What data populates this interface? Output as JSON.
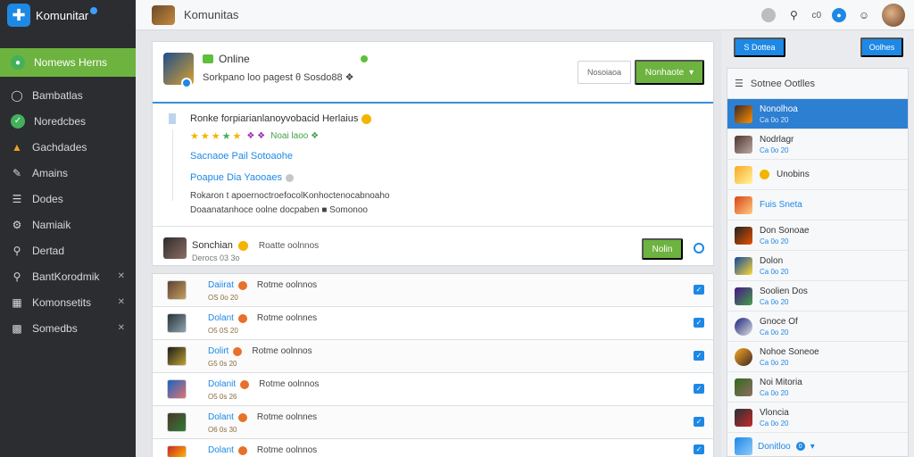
{
  "brand": {
    "name": "Komunitar"
  },
  "sidebar": {
    "items": [
      {
        "label": "Nomews Herns",
        "icon": "globe-icon",
        "active": true
      },
      {
        "label": "Bambatlas",
        "icon": "circle-icon"
      },
      {
        "label": "Noredcbes",
        "icon": "check-circle-icon"
      },
      {
        "label": "Gachdades",
        "icon": "chart-icon"
      },
      {
        "label": "Amains",
        "icon": "pen-icon"
      },
      {
        "label": "Dodes",
        "icon": "list-icon"
      },
      {
        "label": "Namiaik",
        "icon": "settings-icon"
      },
      {
        "label": "Dertad",
        "icon": "pin-icon"
      },
      {
        "label": "BantKorodmik",
        "icon": "search-icon",
        "suffix": "✕"
      },
      {
        "label": "Komonsetits",
        "icon": "grid-icon",
        "suffix": "✕"
      },
      {
        "label": "Somedbs",
        "icon": "bar-chart-icon",
        "suffix": "✕"
      }
    ]
  },
  "topbar": {
    "title": "Komunitas",
    "text_1": "c0",
    "icon_glyph": "☺"
  },
  "post": {
    "status": "Online",
    "subline": "Sorkpano loo pagest  θ  Sosdo88  ❖",
    "btn_outline": "Nosoiaoa",
    "btn_primary": "Nonhaote",
    "title": "Ronke forpiarianlanoyvobacid Herlaius",
    "stars_meta_1": "❖ ❖",
    "stars_meta_2": "Noai laoo  ❖",
    "link_1": "Sacnaoe Pail Sotoaohe",
    "link_2": "Poapue Dia Yaooaes",
    "desc_1": "Rokaron t apoernoctroefocolKonhoctenocabnoaho",
    "desc_2": "Doaanatanhoce oolne docpaben  ■  Somonoo"
  },
  "reply": {
    "name": "Sonchian",
    "status": "Roatte oolnnos",
    "sub": "Derocs 03 3o",
    "button": "Nolin"
  },
  "feed": {
    "rows": [
      {
        "name": "Daiirat",
        "status": "Rotme oolnnos",
        "sub": "OS 0o 20"
      },
      {
        "name": "Dolant",
        "status": "Rotme oolnnes",
        "sub": "O5 0S 20"
      },
      {
        "name": "Dolirt",
        "status": "Rotme oolnnos",
        "sub": "G5 0s 20"
      },
      {
        "name": "Dolanit",
        "status": "Rotme oolnnos",
        "sub": "O5 0s 26"
      },
      {
        "name": "Dolant",
        "status": "Rotme oolnnes",
        "sub": "O6 0s 30"
      },
      {
        "name": "Dolant",
        "status": "Rotme oolnnos",
        "sub": ""
      }
    ]
  },
  "right_panel": {
    "btn_left": "S Dottea",
    "btn_right": "Oolhes",
    "header": "Sotnee Ootlles",
    "items": [
      {
        "name": "Nonolhoa",
        "sub": "Ca 0o 20"
      },
      {
        "name": "Nodrlagr",
        "sub": "Ca 0o 20"
      },
      {
        "name": "Unobins",
        "sub": ""
      },
      {
        "name": "Fuis Sneta",
        "sub": ""
      },
      {
        "name": "Don Sonoae",
        "sub": "Ca 0o 20"
      },
      {
        "name": "Dolon",
        "sub": "Ca 0o 20"
      },
      {
        "name": "Soolien Dos",
        "sub": "Ca 0o 20"
      },
      {
        "name": "Gnoce Of",
        "sub": "Ca 0o 20"
      },
      {
        "name": "Nohoe Soneoe",
        "sub": "Ca 0o 20"
      },
      {
        "name": "Noi Mitoria",
        "sub": "Ca 0o 20"
      },
      {
        "name": "Vloncia",
        "sub": "Ca 0o 20"
      }
    ],
    "footer": "Donitloo",
    "footer_count": "0"
  },
  "colors": {
    "accent_green": "#6db33f",
    "accent_blue": "#1e88e5",
    "sidebar_bg": "#2b2d30"
  }
}
